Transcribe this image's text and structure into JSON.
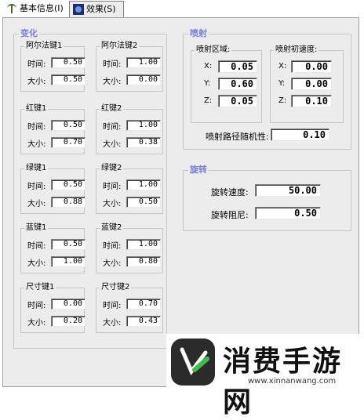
{
  "tabs": [
    {
      "label": "基本信息(I)",
      "icon": "tree-icon"
    },
    {
      "label": "效果(S)",
      "icon": "effect-icon"
    }
  ],
  "change_group": {
    "title": "变化",
    "keys": [
      {
        "title": "阿尔法键1",
        "time_label": "时间:",
        "time": "0.50",
        "size_label": "大小:",
        "size": "0.50"
      },
      {
        "title": "阿尔法键2",
        "time_label": "时间:",
        "time": "1.00",
        "size_label": "大小:",
        "size": "0.00"
      },
      {
        "title": "红键1",
        "time_label": "时间:",
        "time": "0.50",
        "size_label": "大小:",
        "size": "0.70"
      },
      {
        "title": "红键2",
        "time_label": "时间:",
        "time": "1.00",
        "size_label": "大小:",
        "size": "0.38"
      },
      {
        "title": "绿键1",
        "time_label": "时间:",
        "time": "0.50",
        "size_label": "大小:",
        "size": "0.88"
      },
      {
        "title": "绿键2",
        "time_label": "时间:",
        "time": "1.00",
        "size_label": "大小:",
        "size": "0.50"
      },
      {
        "title": "蓝键1",
        "time_label": "时间:",
        "time": "0.50",
        "size_label": "大小:",
        "size": "1.00"
      },
      {
        "title": "蓝键2",
        "time_label": "时间:",
        "time": "1.00",
        "size_label": "大小:",
        "size": "0.80"
      },
      {
        "title": "尺寸键1",
        "time_label": "时间:",
        "time": "0.00",
        "size_label": "大小:",
        "size": "0.20"
      },
      {
        "title": "尺寸键2",
        "time_label": "时间:",
        "time": "0.70",
        "size_label": "大小:",
        "size": "0.43"
      }
    ]
  },
  "emit_group": {
    "title": "喷射",
    "area": {
      "title": "喷射区域:",
      "x_label": "X:",
      "x": "0.05",
      "y_label": "Y:",
      "y": "0.60",
      "z_label": "Z:",
      "z": "0.05"
    },
    "velocity": {
      "title": "喷射初速度:",
      "x_label": "X:",
      "x": "0.00",
      "y_label": "Y:",
      "y": "0.00",
      "z_label": "Z:",
      "z": "0.10"
    },
    "random_label": "喷射路径随机性:",
    "random_value": "0.10"
  },
  "rotate_group": {
    "title": "旋转",
    "speed_label": "旋转速度:",
    "speed_value": "50.00",
    "damping_label": "旋转阻尼:",
    "damping_value": "0.50"
  },
  "watermark": {
    "brand": "消费手游网",
    "url": "www.xinnanwang.com"
  }
}
